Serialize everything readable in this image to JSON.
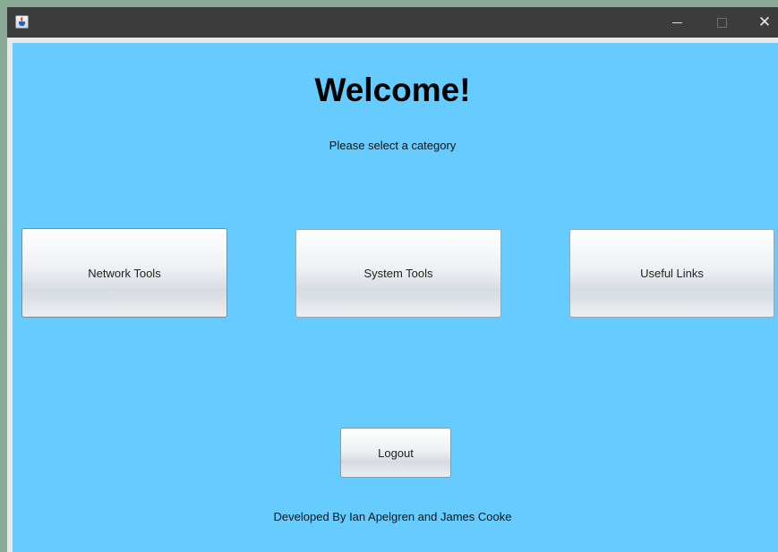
{
  "window": {
    "title": "",
    "controls": {
      "minimize": "minimize",
      "maximize": "maximize",
      "close": "✕"
    },
    "icon": "java-cup-icon"
  },
  "main": {
    "heading": "Welcome!",
    "subtitle": "Please select a category",
    "buttons": {
      "network": "Network Tools",
      "system": "System Tools",
      "links": "Useful Links",
      "logout": "Logout"
    },
    "footer": "Developed By Ian Apelgren and James Cooke"
  },
  "colors": {
    "background": "#66ccff",
    "titlebar": "#3c3c3c"
  }
}
